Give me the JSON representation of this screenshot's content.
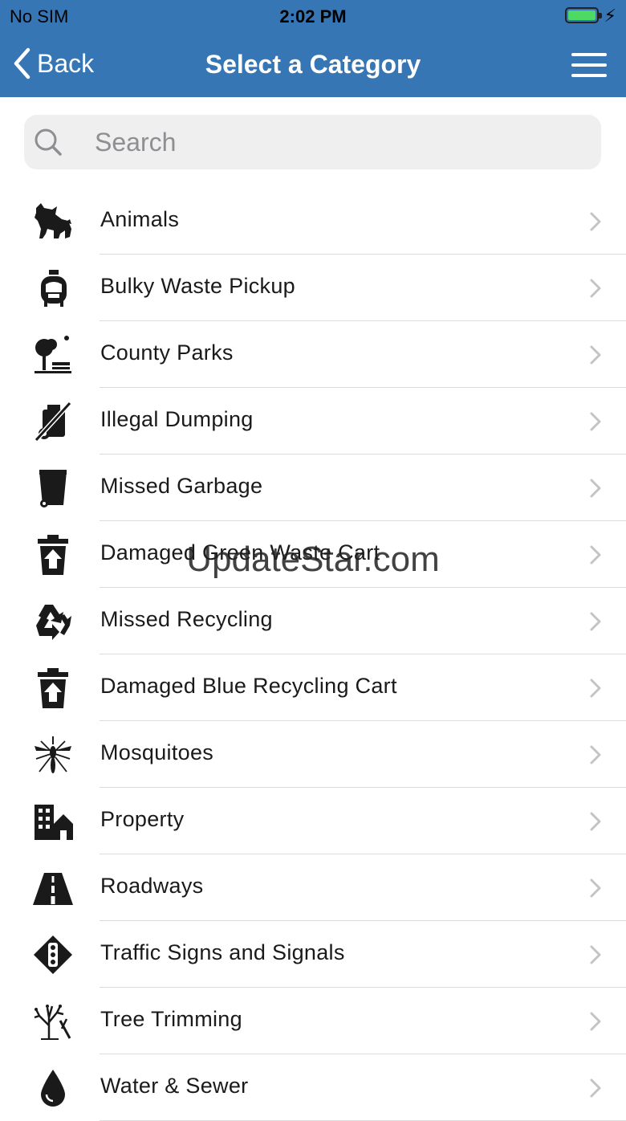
{
  "status_bar": {
    "carrier": "No SIM",
    "time": "2:02 PM",
    "battery_icon": "battery-charging-icon"
  },
  "nav": {
    "back_label": "Back",
    "title": "Select a Category",
    "menu_icon": "hamburger-menu-icon"
  },
  "search": {
    "placeholder": "Search",
    "value": ""
  },
  "categories": [
    {
      "label": "Animals",
      "icon": "dog-cat-icon"
    },
    {
      "label": "Bulky Waste Pickup",
      "icon": "armchair-icon"
    },
    {
      "label": "County Parks",
      "icon": "park-tree-bench-icon"
    },
    {
      "label": "Illegal Dumping",
      "icon": "no-dumping-icon"
    },
    {
      "label": "Missed Garbage",
      "icon": "garbage-bin-icon"
    },
    {
      "label": "Damaged Green Waste Cart",
      "icon": "cart-upload-icon"
    },
    {
      "label": "Missed Recycling",
      "icon": "recycle-icon"
    },
    {
      "label": "Damaged Blue Recycling Cart",
      "icon": "cart-upload-icon"
    },
    {
      "label": "Mosquitoes",
      "icon": "mosquito-icon"
    },
    {
      "label": "Property",
      "icon": "buildings-icon"
    },
    {
      "label": "Roadways",
      "icon": "road-icon"
    },
    {
      "label": "Traffic Signs and Signals",
      "icon": "traffic-signal-icon"
    },
    {
      "label": "Tree Trimming",
      "icon": "tree-trimming-icon"
    },
    {
      "label": "Water & Sewer",
      "icon": "water-drop-icon"
    }
  ],
  "watermark": "UpdateStar.com",
  "colors": {
    "nav_bar": "#3676b4",
    "battery_fill": "#4cd964",
    "separator": "#dcdcdc"
  }
}
